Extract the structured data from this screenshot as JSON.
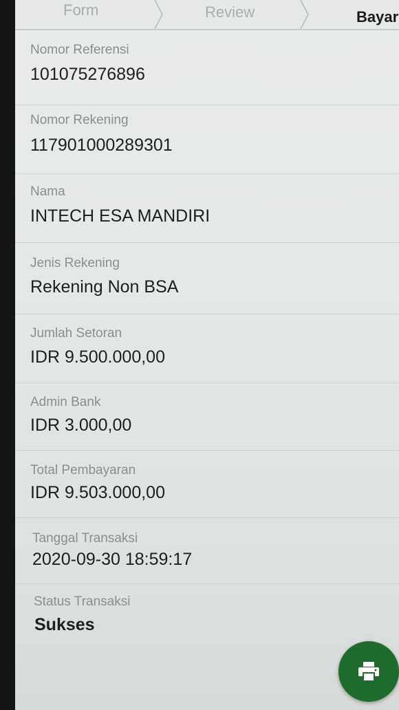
{
  "stepper": {
    "steps": [
      {
        "label": "Form"
      },
      {
        "label": "Review"
      },
      {
        "label": "Bayar"
      }
    ]
  },
  "fields": [
    {
      "label": "Nomor Referensi",
      "value": "101075276896"
    },
    {
      "label": "Nomor Rekening",
      "value": "117901000289301"
    },
    {
      "label": "Nama",
      "value": "INTECH ESA MANDIRI"
    },
    {
      "label": "Jenis Rekening",
      "value": "Rekening Non BSA"
    },
    {
      "label": "Jumlah Setoran",
      "value": "IDR 9.500.000,00"
    },
    {
      "label": "Admin Bank",
      "value": "IDR 3.000,00"
    },
    {
      "label": "Total Pembayaran",
      "value": "IDR 9.503.000,00"
    },
    {
      "label": "Tanggal Transaksi",
      "value": "2020-09-30 18:59:17"
    },
    {
      "label": "Status Transaksi",
      "value": "Sukses"
    }
  ],
  "fab": {
    "icon": "printer-icon",
    "color": "#1e6b2c"
  }
}
